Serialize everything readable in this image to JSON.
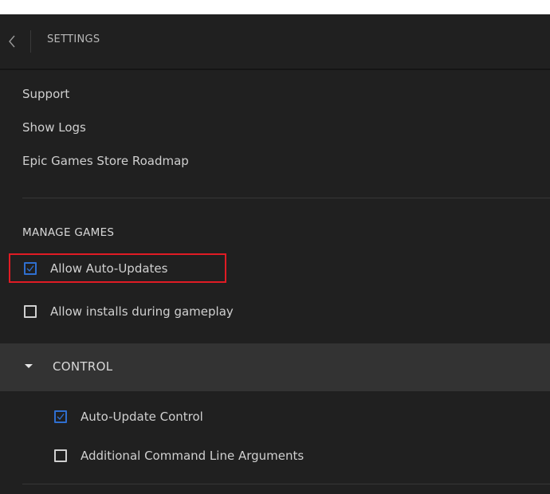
{
  "header": {
    "title": "SETTINGS",
    "back_icon": "chevron-left-icon"
  },
  "links": {
    "support": "Support",
    "show_logs": "Show Logs",
    "roadmap": "Epic Games Store Roadmap"
  },
  "manage_games": {
    "heading": "MANAGE GAMES",
    "options": [
      {
        "label": "Allow Auto-Updates",
        "checked": true,
        "highlighted": true
      },
      {
        "label": "Allow installs during gameplay",
        "checked": false
      }
    ]
  },
  "game_section": {
    "title": "CONTROL",
    "expanded": true,
    "options": [
      {
        "label": "Auto-Update Control",
        "checked": true
      },
      {
        "label": "Additional Command Line Arguments",
        "checked": false
      }
    ]
  },
  "colors": {
    "background": "#202020",
    "accent": "#2f6fd0",
    "highlight": "#e01b24",
    "section_bar": "#333333"
  }
}
